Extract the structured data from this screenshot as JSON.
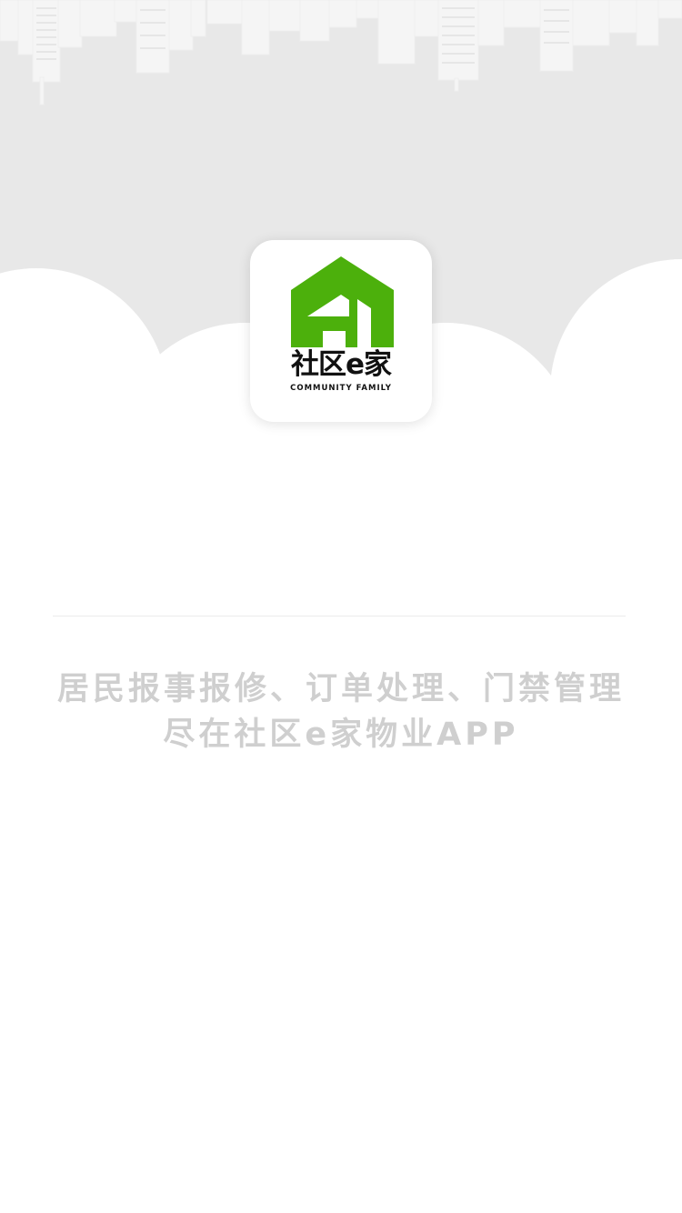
{
  "app": {
    "logo_title": "社区e家",
    "logo_subtitle": "COMMUNITY FAMILY",
    "brand_color": "#4cb00c"
  },
  "background": {
    "skyline_color": "#f4f4f4",
    "sky_color": "#e8e8e8",
    "cloud_color": "#ffffff"
  },
  "tagline": {
    "line1": "居民报事报修、订单处理、门禁管理",
    "line2": "尽在社区e家物业APP"
  }
}
